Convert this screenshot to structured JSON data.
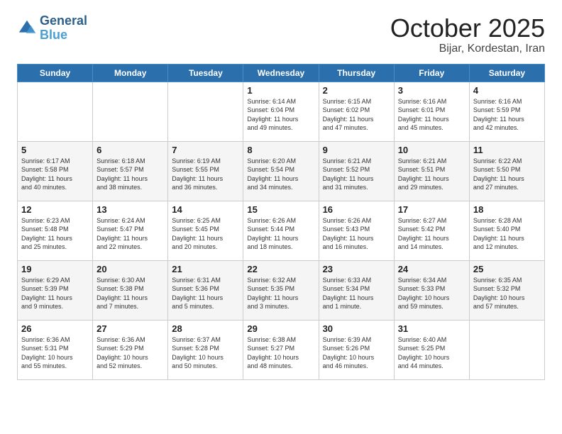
{
  "header": {
    "logo": {
      "line1": "General",
      "line2": "Blue"
    },
    "title": "October 2025",
    "location": "Bijar, Kordestan, Iran"
  },
  "weekdays": [
    "Sunday",
    "Monday",
    "Tuesday",
    "Wednesday",
    "Thursday",
    "Friday",
    "Saturday"
  ],
  "weeks": [
    [
      {
        "day": "",
        "info": ""
      },
      {
        "day": "",
        "info": ""
      },
      {
        "day": "",
        "info": ""
      },
      {
        "day": "1",
        "info": "Sunrise: 6:14 AM\nSunset: 6:04 PM\nDaylight: 11 hours\nand 49 minutes."
      },
      {
        "day": "2",
        "info": "Sunrise: 6:15 AM\nSunset: 6:02 PM\nDaylight: 11 hours\nand 47 minutes."
      },
      {
        "day": "3",
        "info": "Sunrise: 6:16 AM\nSunset: 6:01 PM\nDaylight: 11 hours\nand 45 minutes."
      },
      {
        "day": "4",
        "info": "Sunrise: 6:16 AM\nSunset: 5:59 PM\nDaylight: 11 hours\nand 42 minutes."
      }
    ],
    [
      {
        "day": "5",
        "info": "Sunrise: 6:17 AM\nSunset: 5:58 PM\nDaylight: 11 hours\nand 40 minutes."
      },
      {
        "day": "6",
        "info": "Sunrise: 6:18 AM\nSunset: 5:57 PM\nDaylight: 11 hours\nand 38 minutes."
      },
      {
        "day": "7",
        "info": "Sunrise: 6:19 AM\nSunset: 5:55 PM\nDaylight: 11 hours\nand 36 minutes."
      },
      {
        "day": "8",
        "info": "Sunrise: 6:20 AM\nSunset: 5:54 PM\nDaylight: 11 hours\nand 34 minutes."
      },
      {
        "day": "9",
        "info": "Sunrise: 6:21 AM\nSunset: 5:52 PM\nDaylight: 11 hours\nand 31 minutes."
      },
      {
        "day": "10",
        "info": "Sunrise: 6:21 AM\nSunset: 5:51 PM\nDaylight: 11 hours\nand 29 minutes."
      },
      {
        "day": "11",
        "info": "Sunrise: 6:22 AM\nSunset: 5:50 PM\nDaylight: 11 hours\nand 27 minutes."
      }
    ],
    [
      {
        "day": "12",
        "info": "Sunrise: 6:23 AM\nSunset: 5:48 PM\nDaylight: 11 hours\nand 25 minutes."
      },
      {
        "day": "13",
        "info": "Sunrise: 6:24 AM\nSunset: 5:47 PM\nDaylight: 11 hours\nand 22 minutes."
      },
      {
        "day": "14",
        "info": "Sunrise: 6:25 AM\nSunset: 5:45 PM\nDaylight: 11 hours\nand 20 minutes."
      },
      {
        "day": "15",
        "info": "Sunrise: 6:26 AM\nSunset: 5:44 PM\nDaylight: 11 hours\nand 18 minutes."
      },
      {
        "day": "16",
        "info": "Sunrise: 6:26 AM\nSunset: 5:43 PM\nDaylight: 11 hours\nand 16 minutes."
      },
      {
        "day": "17",
        "info": "Sunrise: 6:27 AM\nSunset: 5:42 PM\nDaylight: 11 hours\nand 14 minutes."
      },
      {
        "day": "18",
        "info": "Sunrise: 6:28 AM\nSunset: 5:40 PM\nDaylight: 11 hours\nand 12 minutes."
      }
    ],
    [
      {
        "day": "19",
        "info": "Sunrise: 6:29 AM\nSunset: 5:39 PM\nDaylight: 11 hours\nand 9 minutes."
      },
      {
        "day": "20",
        "info": "Sunrise: 6:30 AM\nSunset: 5:38 PM\nDaylight: 11 hours\nand 7 minutes."
      },
      {
        "day": "21",
        "info": "Sunrise: 6:31 AM\nSunset: 5:36 PM\nDaylight: 11 hours\nand 5 minutes."
      },
      {
        "day": "22",
        "info": "Sunrise: 6:32 AM\nSunset: 5:35 PM\nDaylight: 11 hours\nand 3 minutes."
      },
      {
        "day": "23",
        "info": "Sunrise: 6:33 AM\nSunset: 5:34 PM\nDaylight: 11 hours\nand 1 minute."
      },
      {
        "day": "24",
        "info": "Sunrise: 6:34 AM\nSunset: 5:33 PM\nDaylight: 10 hours\nand 59 minutes."
      },
      {
        "day": "25",
        "info": "Sunrise: 6:35 AM\nSunset: 5:32 PM\nDaylight: 10 hours\nand 57 minutes."
      }
    ],
    [
      {
        "day": "26",
        "info": "Sunrise: 6:36 AM\nSunset: 5:31 PM\nDaylight: 10 hours\nand 55 minutes."
      },
      {
        "day": "27",
        "info": "Sunrise: 6:36 AM\nSunset: 5:29 PM\nDaylight: 10 hours\nand 52 minutes."
      },
      {
        "day": "28",
        "info": "Sunrise: 6:37 AM\nSunset: 5:28 PM\nDaylight: 10 hours\nand 50 minutes."
      },
      {
        "day": "29",
        "info": "Sunrise: 6:38 AM\nSunset: 5:27 PM\nDaylight: 10 hours\nand 48 minutes."
      },
      {
        "day": "30",
        "info": "Sunrise: 6:39 AM\nSunset: 5:26 PM\nDaylight: 10 hours\nand 46 minutes."
      },
      {
        "day": "31",
        "info": "Sunrise: 6:40 AM\nSunset: 5:25 PM\nDaylight: 10 hours\nand 44 minutes."
      },
      {
        "day": "",
        "info": ""
      }
    ]
  ]
}
